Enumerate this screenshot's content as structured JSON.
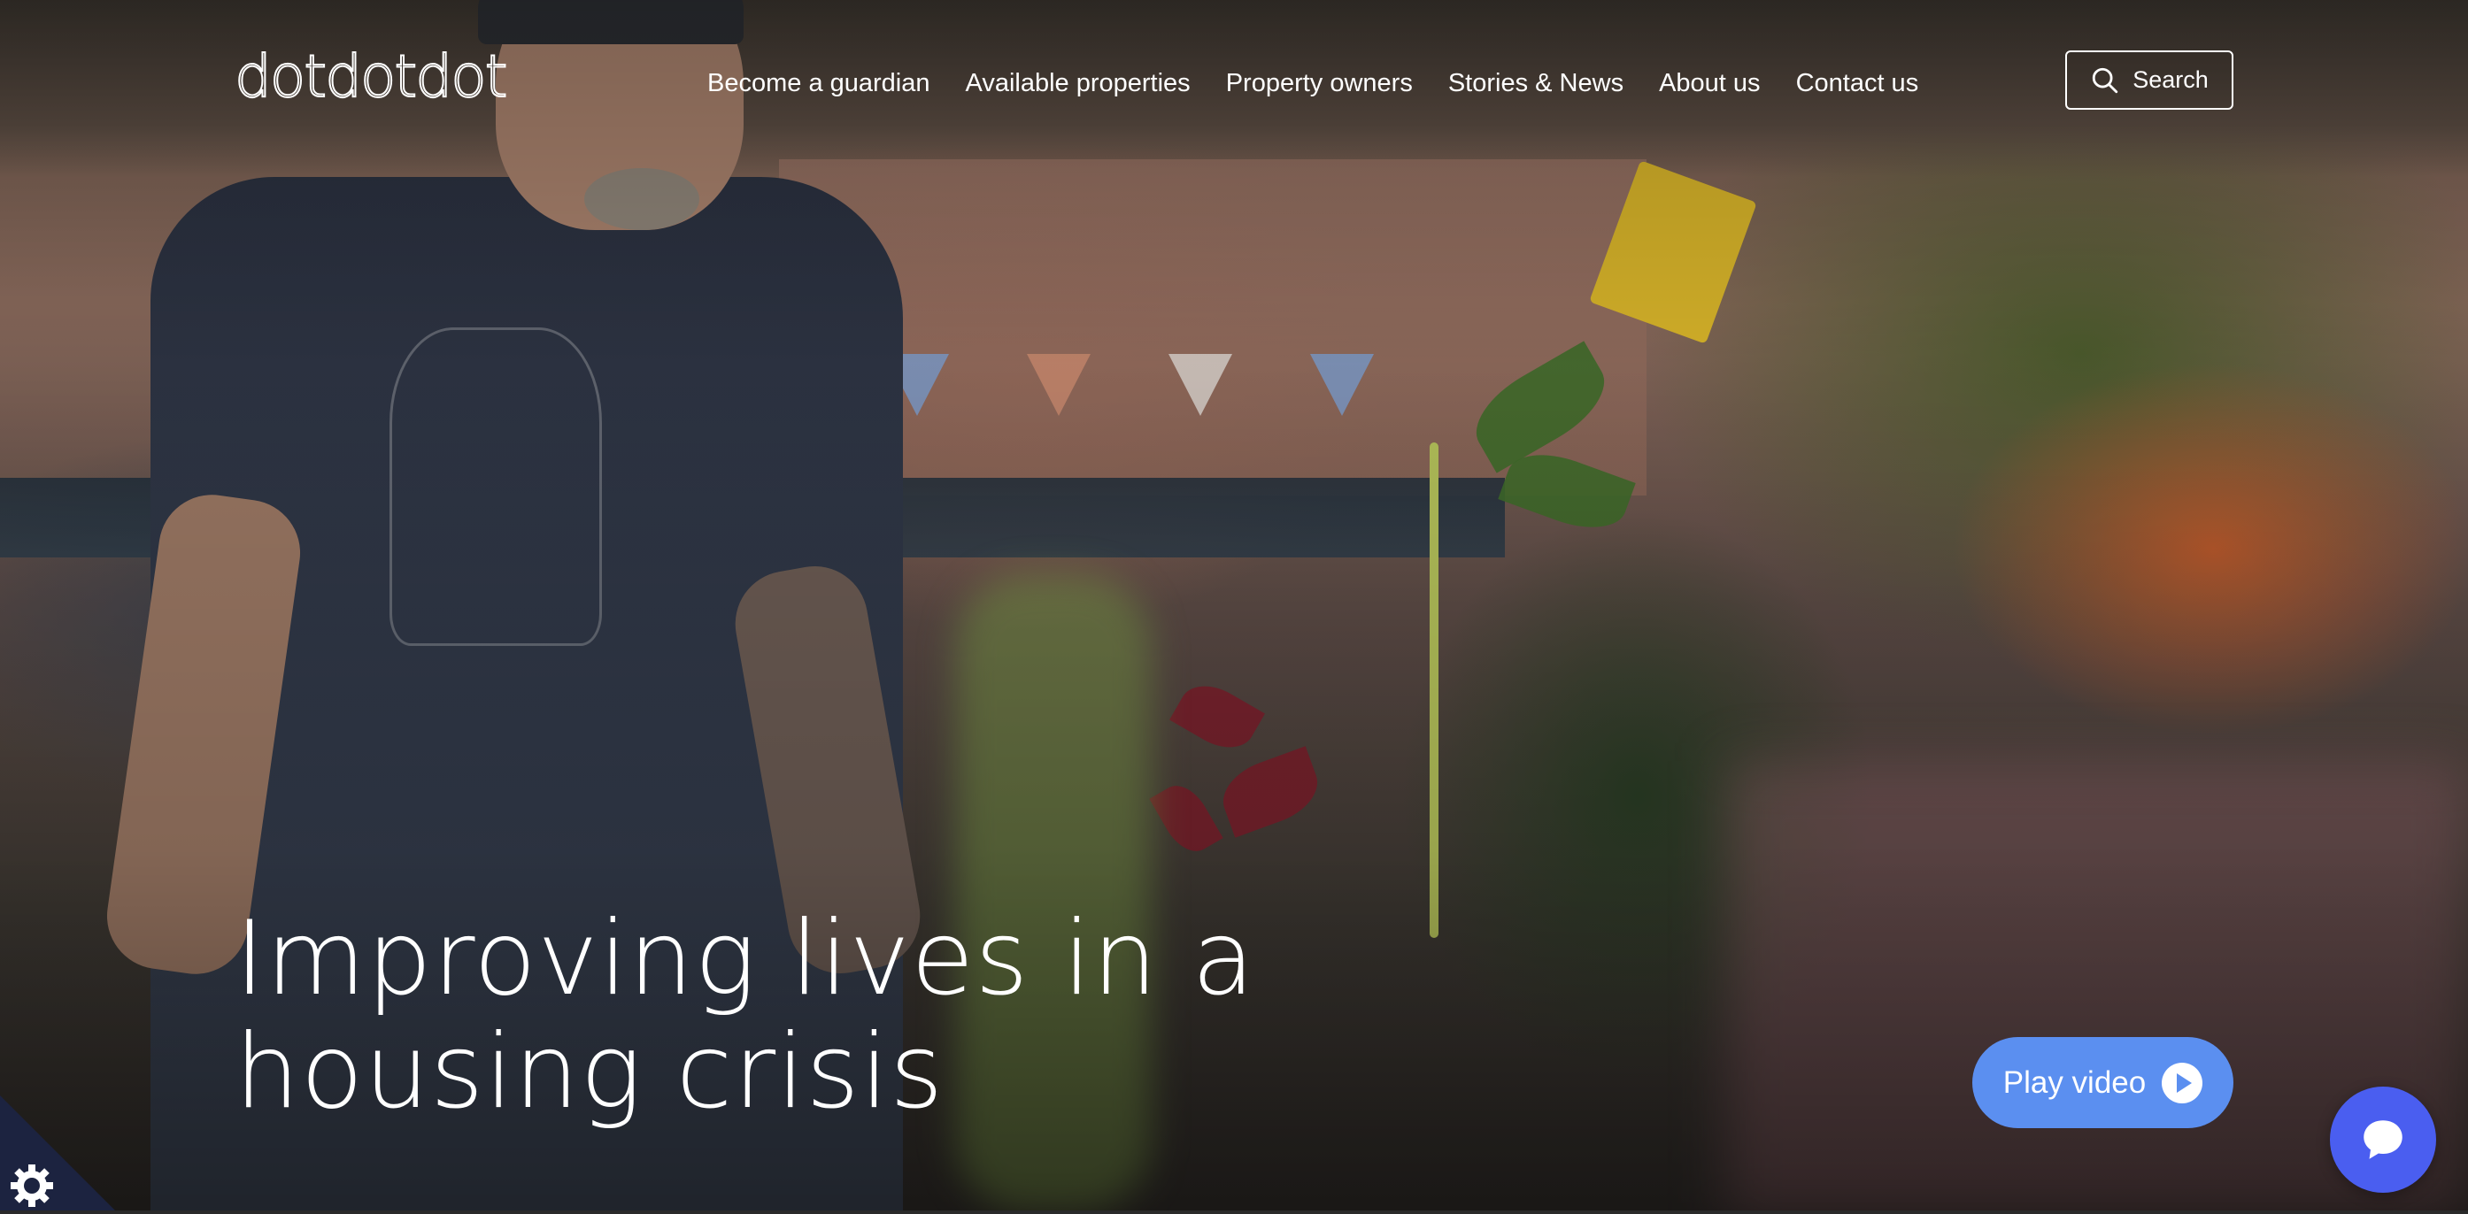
{
  "header": {
    "logo_text": "dotdotdot",
    "nav": [
      {
        "label": "Become a guardian"
      },
      {
        "label": "Available properties"
      },
      {
        "label": "Property owners"
      },
      {
        "label": "Stories & News"
      },
      {
        "label": "About us"
      },
      {
        "label": "Contact us"
      }
    ],
    "search_label": "Search"
  },
  "hero": {
    "headline_line1": "Improving lives in a",
    "headline_line2": "housing crisis",
    "play_label": "Play video"
  },
  "colors": {
    "play_button": "#5b8ff0",
    "chat_button": "#4a5ef0",
    "cookie_badge": "#1c2340"
  },
  "icons": {
    "search": "search-icon",
    "play": "play-icon",
    "chat": "chat-bubble-icon",
    "cookie": "cookie-settings-icon"
  }
}
